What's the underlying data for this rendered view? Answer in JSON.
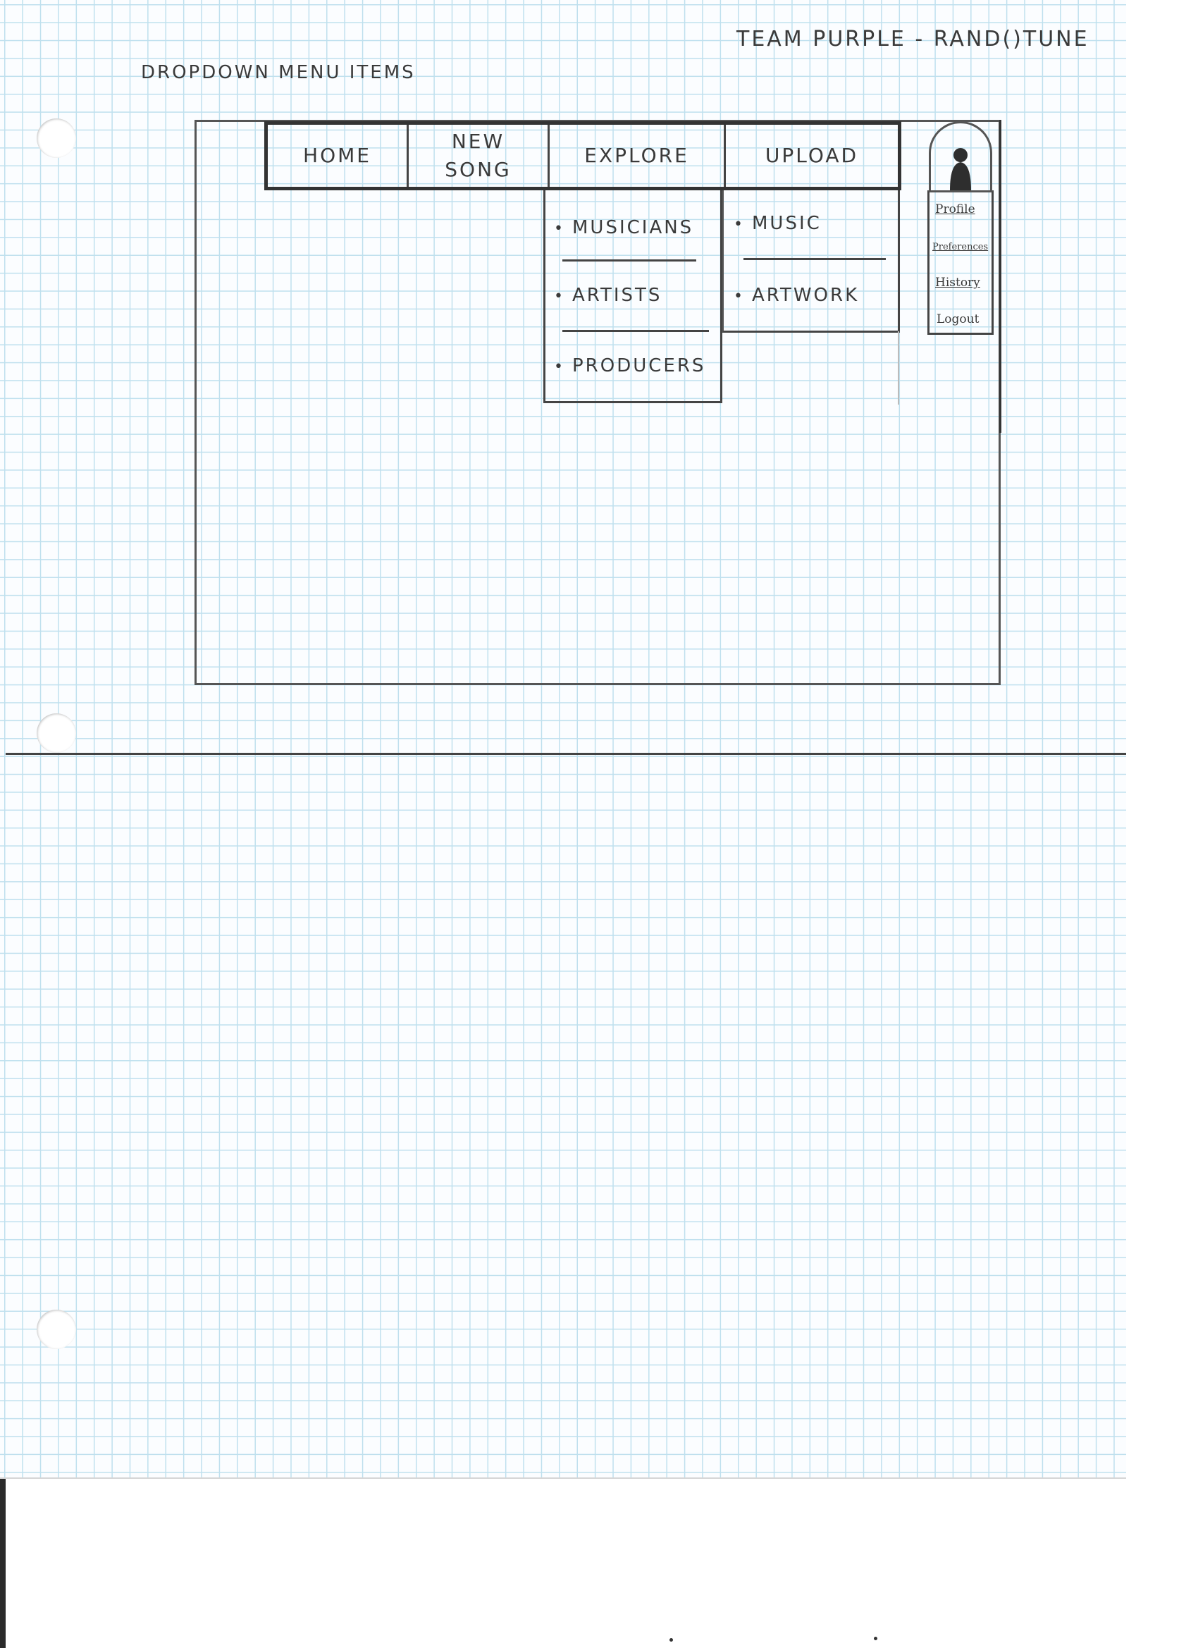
{
  "header": {
    "title": "TEAM PURPLE - RAND()TUNE",
    "subtitle": "DROPDOWN MENU ITEMS"
  },
  "navbar": {
    "items": [
      {
        "label": "HOME"
      },
      {
        "label": "NEW SONG"
      },
      {
        "label": "EXPLORE"
      },
      {
        "label": "UPLOAD"
      }
    ]
  },
  "dropdowns": {
    "explore": [
      "MUSICIANS",
      "ARTISTS",
      "PRODUCERS"
    ],
    "upload": [
      "MUSIC",
      "ARTWORK"
    ]
  },
  "profile_menu": {
    "items": [
      "Profile",
      "Preferences",
      "History",
      "Logout"
    ]
  },
  "colors": {
    "pencil": "#3a3a3a",
    "grid": "#bfe0ee",
    "paper": "#fbfdff"
  },
  "icons": {
    "avatar": "user-silhouette-icon"
  }
}
